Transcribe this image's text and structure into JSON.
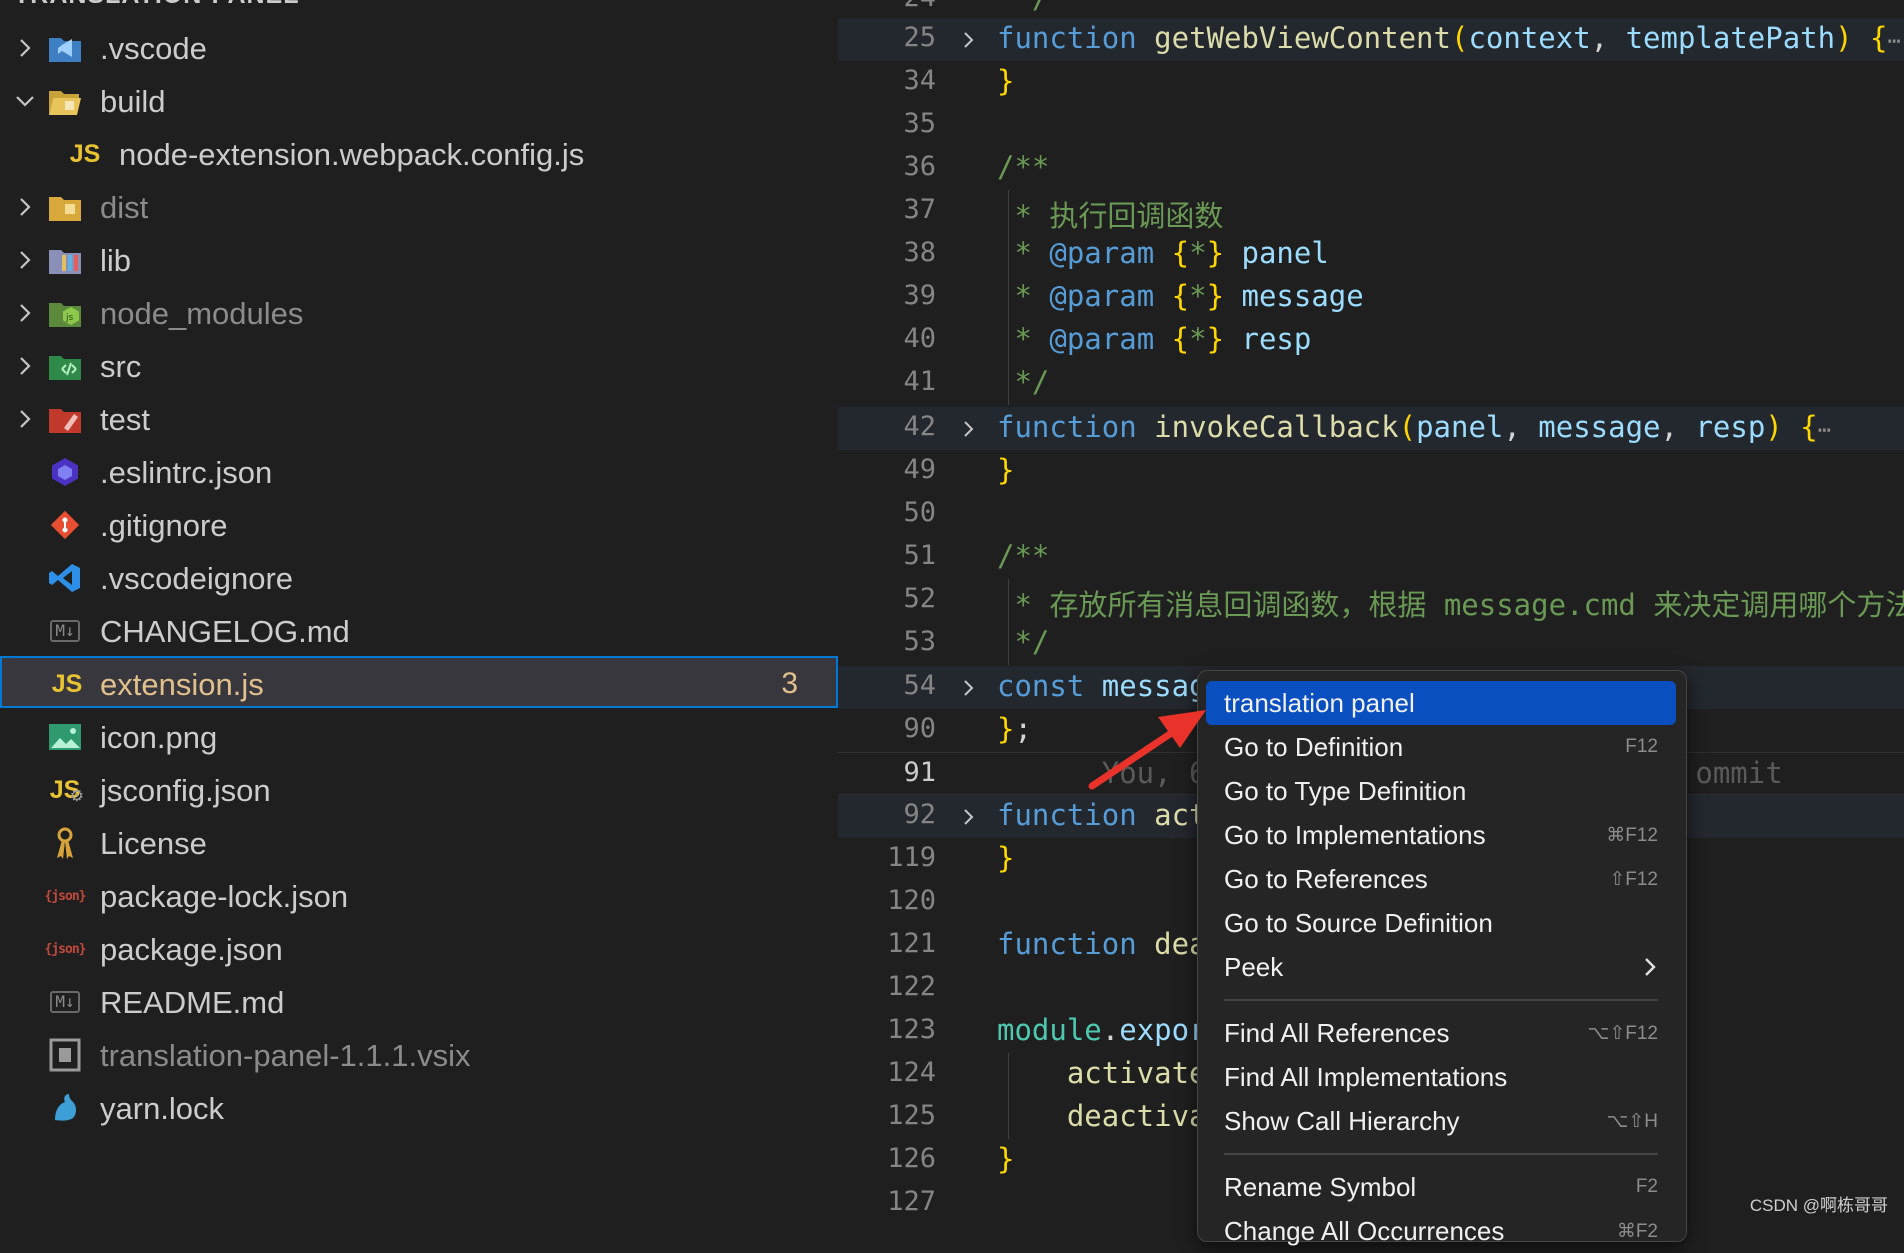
{
  "explorer": {
    "title": "TRANSLATION-PANEL",
    "items": [
      {
        "label": ".vscode",
        "icon": "vscode-folder-icon",
        "chevron": "right"
      },
      {
        "label": "build",
        "icon": "build-folder-open-icon",
        "chevron": "down"
      },
      {
        "label": "node-extension.webpack.config.js",
        "icon": "js-file-icon"
      },
      {
        "label": "dist",
        "icon": "dist-folder-icon",
        "chevron": "right",
        "muted": true
      },
      {
        "label": "lib",
        "icon": "lib-folder-icon",
        "chevron": "right"
      },
      {
        "label": "node_modules",
        "icon": "node-modules-folder-icon",
        "chevron": "right",
        "muted": true
      },
      {
        "label": "src",
        "icon": "src-folder-icon",
        "chevron": "right"
      },
      {
        "label": "test",
        "icon": "test-folder-icon",
        "chevron": "right"
      },
      {
        "label": ".eslintrc.json",
        "icon": "eslint-icon"
      },
      {
        "label": ".gitignore",
        "icon": "git-icon"
      },
      {
        "label": ".vscodeignore",
        "icon": "vscode-icon"
      },
      {
        "label": "CHANGELOG.md",
        "icon": "markdown-icon"
      },
      {
        "label": "extension.js",
        "icon": "js-file-icon",
        "selected": true,
        "badge": "3"
      },
      {
        "label": "icon.png",
        "icon": "image-icon"
      },
      {
        "label": "jsconfig.json",
        "icon": "jsconfig-icon"
      },
      {
        "label": "License",
        "icon": "license-icon"
      },
      {
        "label": "package-lock.json",
        "icon": "npm-json-icon"
      },
      {
        "label": "package.json",
        "icon": "npm-json-icon"
      },
      {
        "label": "README.md",
        "icon": "markdown-icon"
      },
      {
        "label": "translation-panel-1.1.1.vsix",
        "icon": "vsix-icon",
        "muted": true
      },
      {
        "label": "yarn.lock",
        "icon": "yarn-icon"
      }
    ]
  },
  "editor": {
    "active_line": "91",
    "lines": [
      {
        "n": "24",
        "text": "  */"
      },
      {
        "n": "25",
        "text": "function getWebViewContent(context, templatePath) {"
      },
      {
        "n": "34",
        "text": "}"
      },
      {
        "n": "35",
        "text": ""
      },
      {
        "n": "36",
        "text": "/**"
      },
      {
        "n": "37",
        "text": " * 执行回调函数"
      },
      {
        "n": "38",
        "text": " * @param {*} panel"
      },
      {
        "n": "39",
        "text": " * @param {*} message"
      },
      {
        "n": "40",
        "text": " * @param {*} resp"
      },
      {
        "n": "41",
        "text": " */"
      },
      {
        "n": "42",
        "text": "function invokeCallback(panel, message, resp) {"
      },
      {
        "n": "49",
        "text": "}"
      },
      {
        "n": "50",
        "text": ""
      },
      {
        "n": "51",
        "text": "/**"
      },
      {
        "n": "52",
        "text": " * 存放所有消息回调函数，根据 message.cmd 来决定调用哪个方法"
      },
      {
        "n": "53",
        "text": " */"
      },
      {
        "n": "54",
        "text": "const messag"
      },
      {
        "n": "90",
        "text": "};"
      },
      {
        "n": "91",
        "text": "      You, 6                            ommit"
      },
      {
        "n": "92",
        "text": "function act"
      },
      {
        "n": "119",
        "text": "}"
      },
      {
        "n": "120",
        "text": ""
      },
      {
        "n": "121",
        "text": "function dea"
      },
      {
        "n": "122",
        "text": ""
      },
      {
        "n": "123",
        "text": "module.expor"
      },
      {
        "n": "124",
        "text": "    activate"
      },
      {
        "n": "125",
        "text": "    deactiva"
      },
      {
        "n": "126",
        "text": "}"
      },
      {
        "n": "127",
        "text": ""
      }
    ],
    "fold_ellipsis": "⋯"
  },
  "context_menu": {
    "items": [
      {
        "label": "translation panel",
        "shortcut": "",
        "active": true
      },
      {
        "label": "Go to Definition",
        "shortcut": "F12"
      },
      {
        "label": "Go to Type Definition",
        "shortcut": ""
      },
      {
        "label": "Go to Implementations",
        "shortcut": "⌘F12"
      },
      {
        "label": "Go to References",
        "shortcut": "⇧F12"
      },
      {
        "label": "Go to Source Definition",
        "shortcut": ""
      },
      {
        "label": "Peek",
        "shortcut": "",
        "submenu": true
      },
      {
        "label": "Find All References",
        "shortcut": "⌥⇧F12"
      },
      {
        "label": "Find All Implementations",
        "shortcut": ""
      },
      {
        "label": "Show Call Hierarchy",
        "shortcut": "⌥⇧H"
      },
      {
        "label": "Rename Symbol",
        "shortcut": "F2"
      },
      {
        "label": "Change All Occurrences",
        "shortcut": "⌘F2"
      }
    ]
  },
  "watermark": "CSDN @啊栋哥哥",
  "colors": {
    "accent": "#0078d4",
    "menu_highlight": "#0a4fc0",
    "arrow": "#e8322a",
    "keyword": "#569cd6",
    "function": "#dcdcaa",
    "comment": "#6a9955"
  }
}
